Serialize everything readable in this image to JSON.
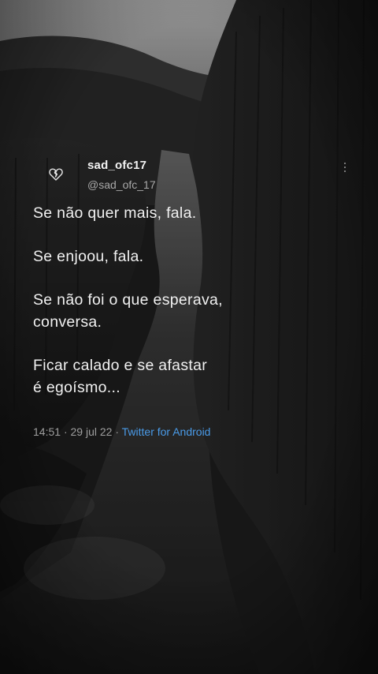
{
  "tweet": {
    "username": "sad_ofc17",
    "handle": "@sad_ofc_17",
    "paragraphs": [
      "Se não quer mais, fala.",
      "Se enjoou, fala.",
      "Se não foi o que esperava, conversa.",
      "Ficar calado e se afastar é egoísmo..."
    ],
    "lines": {
      "p1": "Se não quer mais, fala.",
      "p2": "Se enjoou, fala.",
      "p3a": "Se não foi o que esperava,",
      "p3b": "conversa.",
      "p4a": "Ficar calado e se afastar",
      "p4b": "é egoísmo..."
    },
    "time": "14:51",
    "date": "29 jul 22",
    "separator": "·",
    "client": "Twitter for Android"
  },
  "icons": {
    "avatar": "broken-heart-icon",
    "more": "more-vertical-icon"
  },
  "colors": {
    "text": "#f1f1f1",
    "muted": "#9e9e9e",
    "link": "#4a9be8"
  }
}
